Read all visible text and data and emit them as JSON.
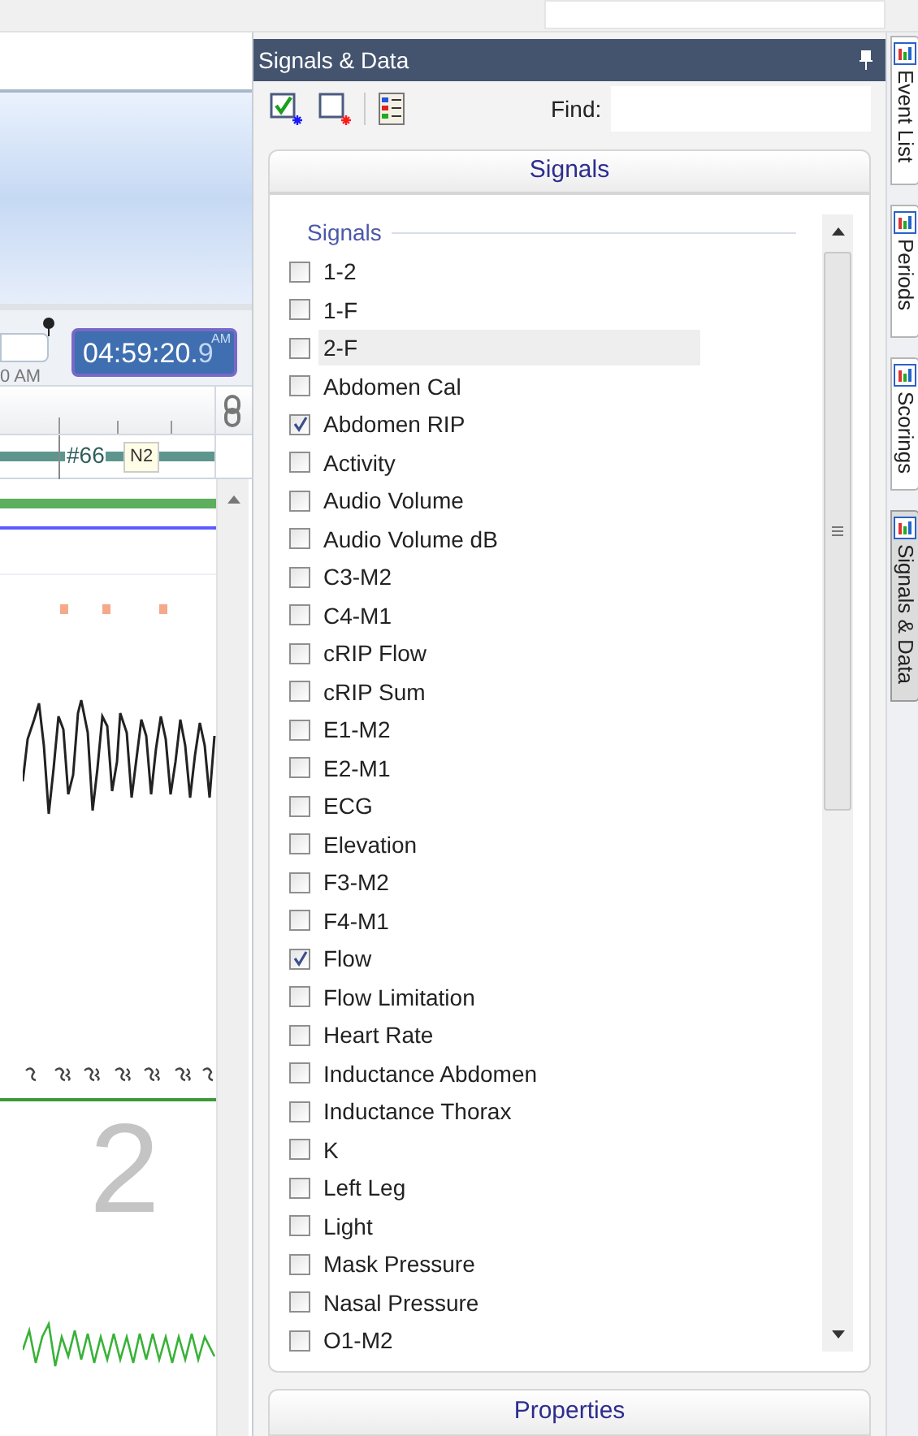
{
  "viewer": {
    "clock": {
      "time": "04:59:20.",
      "fraction": "9",
      "meridiem": "AM"
    },
    "axis_label": "0 AM",
    "hypnogram": {
      "marker": "#66",
      "stage": "N2"
    },
    "stage_watermark": "2"
  },
  "panel": {
    "title": "Signals & Data",
    "find_label": "Find:",
    "section": "Signals",
    "group": "Signals",
    "footer_section": "Properties",
    "signals": [
      {
        "label": "1-2",
        "checked": false,
        "selected": false
      },
      {
        "label": "1-F",
        "checked": false,
        "selected": false
      },
      {
        "label": "2-F",
        "checked": false,
        "selected": true
      },
      {
        "label": "Abdomen Cal",
        "checked": false,
        "selected": false
      },
      {
        "label": "Abdomen RIP",
        "checked": true,
        "selected": false
      },
      {
        "label": "Activity",
        "checked": false,
        "selected": false
      },
      {
        "label": "Audio Volume",
        "checked": false,
        "selected": false
      },
      {
        "label": "Audio Volume dB",
        "checked": false,
        "selected": false
      },
      {
        "label": "C3-M2",
        "checked": false,
        "selected": false
      },
      {
        "label": "C4-M1",
        "checked": false,
        "selected": false
      },
      {
        "label": "cRIP Flow",
        "checked": false,
        "selected": false
      },
      {
        "label": "cRIP Sum",
        "checked": false,
        "selected": false
      },
      {
        "label": "E1-M2",
        "checked": false,
        "selected": false
      },
      {
        "label": "E2-M1",
        "checked": false,
        "selected": false
      },
      {
        "label": "ECG",
        "checked": false,
        "selected": false
      },
      {
        "label": "Elevation",
        "checked": false,
        "selected": false
      },
      {
        "label": "F3-M2",
        "checked": false,
        "selected": false
      },
      {
        "label": "F4-M1",
        "checked": false,
        "selected": false
      },
      {
        "label": "Flow",
        "checked": true,
        "selected": false
      },
      {
        "label": "Flow Limitation",
        "checked": false,
        "selected": false
      },
      {
        "label": "Heart Rate",
        "checked": false,
        "selected": false
      },
      {
        "label": "Inductance Abdomen",
        "checked": false,
        "selected": false
      },
      {
        "label": "Inductance Thorax",
        "checked": false,
        "selected": false
      },
      {
        "label": "K",
        "checked": false,
        "selected": false
      },
      {
        "label": "Left Leg",
        "checked": false,
        "selected": false
      },
      {
        "label": "Light",
        "checked": false,
        "selected": false
      },
      {
        "label": "Mask Pressure",
        "checked": false,
        "selected": false
      },
      {
        "label": "Nasal Pressure",
        "checked": false,
        "selected": false
      },
      {
        "label": "O1-M2",
        "checked": false,
        "selected": false
      }
    ]
  },
  "side_tabs": [
    {
      "label": "Event List",
      "selected": false
    },
    {
      "label": "Periods",
      "selected": false
    },
    {
      "label": "Scorings",
      "selected": false
    },
    {
      "label": "Signals & Data",
      "selected": true
    }
  ]
}
